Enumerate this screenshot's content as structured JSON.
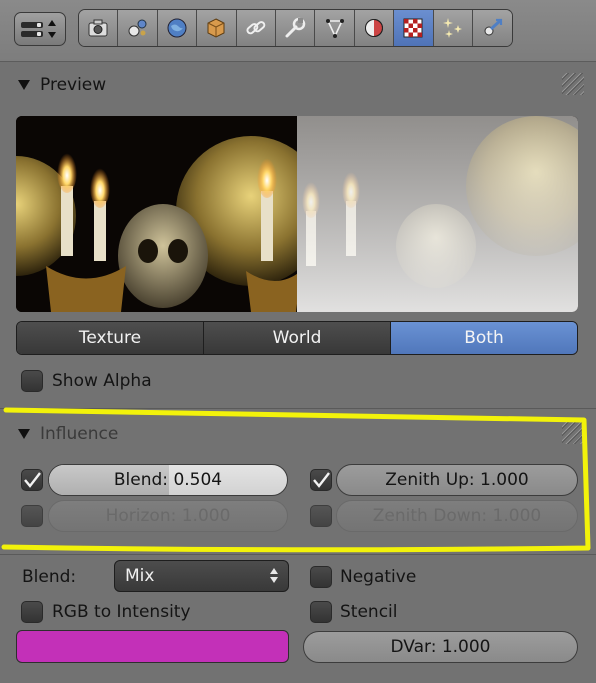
{
  "header": {
    "editor_type_icon": "properties-editor-icon",
    "tabs": [
      {
        "icon": "render-icon"
      },
      {
        "icon": "scene-icon"
      },
      {
        "icon": "world-icon"
      },
      {
        "icon": "object-icon"
      },
      {
        "icon": "constraints-icon"
      },
      {
        "icon": "modifiers-icon"
      },
      {
        "icon": "object-data-icon"
      },
      {
        "icon": "material-icon"
      },
      {
        "icon": "texture-icon",
        "active": true
      },
      {
        "icon": "particles-icon"
      },
      {
        "icon": "physics-icon"
      }
    ]
  },
  "preview_panel": {
    "title": "Preview",
    "image": "texture-preview-image",
    "modes": [
      "Texture",
      "World",
      "Both"
    ],
    "active_mode": "Both",
    "show_alpha_label": "Show Alpha",
    "show_alpha_checked": false
  },
  "influence_panel": {
    "title": "Influence",
    "blend_slider": {
      "label": "Blend:",
      "value": "0.504",
      "checked": true,
      "fraction": 0.504
    },
    "zenith_up": {
      "text": "Zenith Up: 1.000",
      "checked": true
    },
    "horizon": {
      "text": "Horizon: 1.000",
      "checked": false
    },
    "zenith_down": {
      "text": "Zenith Down: 1.000",
      "checked": false
    }
  },
  "options": {
    "blend_label": "Blend:",
    "blend_mode": "Mix",
    "negative_label": "Negative",
    "negative_checked": false,
    "rgb_to_intensity_label": "RGB to Intensity",
    "rgb_to_intensity_checked": false,
    "stencil_label": "Stencil",
    "stencil_checked": false,
    "color": "#c330b8",
    "dvar_text": "DVar: 1.000"
  },
  "colors": {
    "panel_bg": "#727272",
    "active_tab": "#5a7ec2",
    "highlight_frame": "#f2f20a"
  }
}
